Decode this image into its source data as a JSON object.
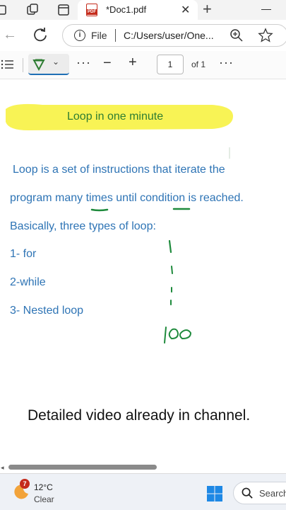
{
  "browser": {
    "tab_title": "*Doc1.pdf",
    "pdf_badge": "PDF",
    "close_glyph": "✕",
    "new_tab_glyph": "+",
    "address": {
      "scheme_label": "File",
      "url": "C:/Users/user/One..."
    }
  },
  "pdf_toolbar": {
    "more_glyph": "···",
    "zoom_out_glyph": "−",
    "zoom_in_glyph": "+",
    "page_number": "1",
    "page_total": "of 1",
    "draw_chevron": "⌄",
    "draw_color": "#2e7d32"
  },
  "document": {
    "title": "Loop in one minute",
    "lines": [
      "Loop is a set of instructions that iterate the",
      "program many times until condition is reached.",
      "Basically, three types of loop:",
      "1- for",
      "2-while",
      "3- Nested loop"
    ],
    "caption": "Detailed video already in channel.",
    "colors": {
      "highlight": "#f7f247",
      "title": "#2e7d32",
      "body": "#2e74b5",
      "ink": "#1e8a3c"
    },
    "ink_annotations": [
      "underline-icon",
      "tally-marks-icon",
      "handwritten-100-icon"
    ]
  },
  "taskbar": {
    "weather_badge": "7",
    "temperature": "12°C",
    "condition": "Clear",
    "search_placeholder": "Search"
  }
}
